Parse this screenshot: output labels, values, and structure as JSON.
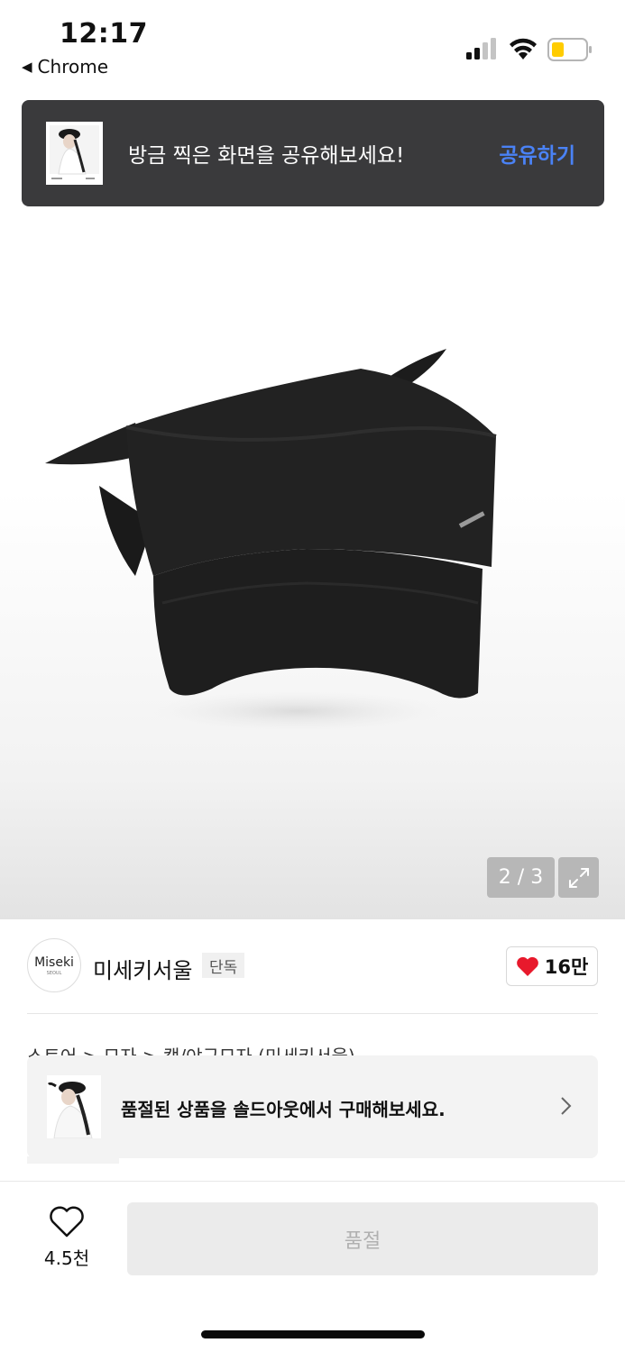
{
  "status_bar": {
    "time": "12:17",
    "back_app": "Chrome",
    "signal_icon": "cellular-signal-icon",
    "wifi_icon": "wifi-icon",
    "battery_icon": "battery-icon",
    "battery_color": "#ffcc00"
  },
  "share_banner": {
    "message": "방금 찍은 화면을 공유해보세요!",
    "action": "공유하기",
    "action_color": "#4a82f6"
  },
  "product_image": {
    "pager": "2 / 3",
    "expand_icon": "expand-icon"
  },
  "brand": {
    "logo_text": "Miseki",
    "logo_subtext": "SEOUL",
    "name": "미세키서울",
    "badge": "단독",
    "like_count": "16만",
    "like_color": "#e8192c"
  },
  "breadcrumb": {
    "text": "스토어 > 모자 > 캡/야구모자 (미세키서울)"
  },
  "soldout_toast": {
    "message": "품절된 상품을 솔드아웃에서 구매해보세요."
  },
  "bottom_bar": {
    "wish_count": "4.5천",
    "buy_button": "품절"
  }
}
